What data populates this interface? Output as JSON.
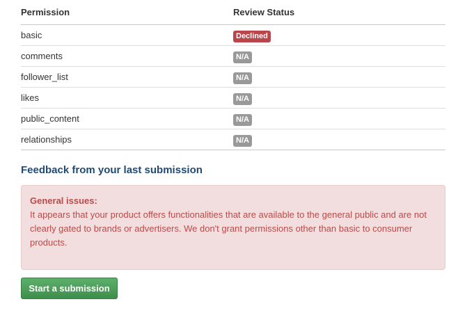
{
  "table": {
    "headers": {
      "permission": "Permission",
      "review_status": "Review Status"
    },
    "rows": [
      {
        "permission": "basic",
        "status": "Declined",
        "status_type": "declined"
      },
      {
        "permission": "comments",
        "status": "N/A",
        "status_type": "na"
      },
      {
        "permission": "follower_list",
        "status": "N/A",
        "status_type": "na"
      },
      {
        "permission": "likes",
        "status": "N/A",
        "status_type": "na"
      },
      {
        "permission": "public_content",
        "status": "N/A",
        "status_type": "na"
      },
      {
        "permission": "relationships",
        "status": "N/A",
        "status_type": "na"
      }
    ]
  },
  "feedback": {
    "title": "Feedback from your last submission",
    "heading": "General issues:",
    "message": "It appears that your product offers functionalities that are available to the general public and are not clearly gated to brands or advertisers. We don't grant permissions other than basic to consumer products."
  },
  "actions": {
    "submit_label": "Start a submission"
  },
  "colors": {
    "declined": "#b9464a",
    "na": "#999999",
    "alert_bg": "#f2dede",
    "alert_text": "#b94a48",
    "title": "#1f4a74",
    "button": "#4a9d58"
  }
}
